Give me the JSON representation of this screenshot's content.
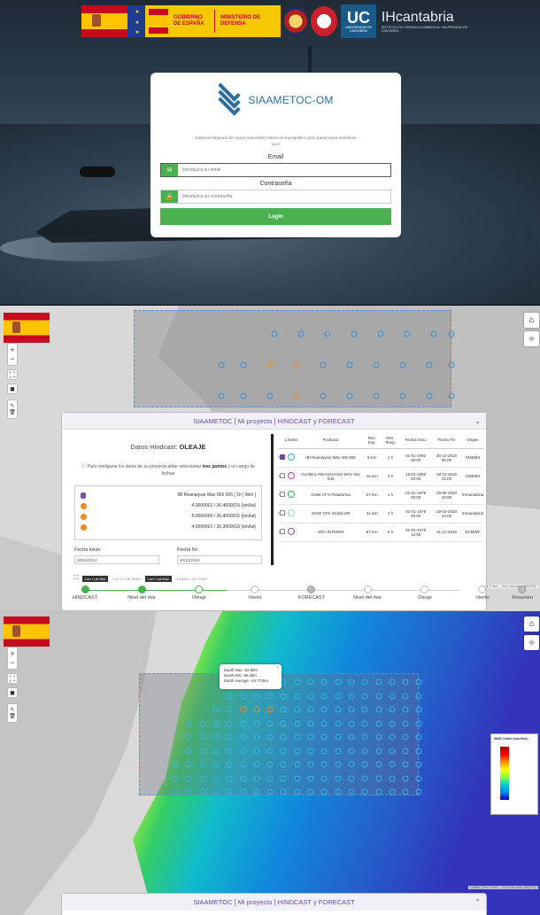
{
  "login": {
    "brand": "SIAAMETOC-OM",
    "subtitle": "- Sistema Integrado de Apoyo Automático Meteo-Oceanográfico para operaciones marítimas -",
    "version": "v1.0",
    "email_label": "Email",
    "email_placeholder": "Introduzca su email",
    "password_label": "Contraseña",
    "password_placeholder": "Introduzca su contraseña",
    "login_button": "Login",
    "logos": {
      "gobierno": "GOBIERNO DE ESPAÑA",
      "ministerio": "MINISTERIO DE DEFENSA",
      "uc": "UC",
      "uc_sub": "UNIVERSIDAD DE CANTABRIA",
      "ih": "IHcantabria",
      "ih_sub": "INSTITUTO DE HIDRÁULICA AMBIENTAL UNIVERSIDAD DE CANTABRIA"
    }
  },
  "modal": {
    "title": "SIAAMETOC [ Mi proyecto ] HINDCAST y FORECAST",
    "heading_prefix": "Datos Hindcast:",
    "heading_value": "OLEAJE",
    "hint_prefix": "Para configurar los datos de su proyecto debe seleccionar",
    "hint_bold": "tres puntos",
    "hint_suffix": "y un rango de fechas",
    "product_line": "IBI Reanalysis Wav 005 006 [ 1h | 9km ]",
    "points": [
      "-4.9000001 / 36.4000015 (lon/lat)",
      "-5.0000000 / 36.4000015 (lon/lat)",
      "-4.9000001 / 36.3000018 (lon/lat)"
    ],
    "start_label": "Fecha inicio:",
    "start_value": "28/12/2014",
    "end_label": "Fecha fin:",
    "end_value": "30/12/2019",
    "lonlat_min_tag": "Lon / Lat Min",
    "lonlat_min": "-5.0771 / 36.30464",
    "lonlat_max_tag": "Lon / Lat Max",
    "lonlat_max": "-4.83464 / 36.77409",
    "table_headers": [
      "Límites",
      "Producto",
      "Res. Esp.",
      "Res. Temp.",
      "Fecha Inicio",
      "Fecha Fin",
      "Origen"
    ],
    "table_rows": [
      {
        "producto": "IBI Reanalysis Wav 005 006",
        "esp": "9 Km",
        "temp": "1 h",
        "inicio": "01-01-1992 00:00",
        "fin": "30-12-2019 00:00",
        "origen": "CMEMS",
        "color": "#2bb3a6",
        "checked": true
      },
      {
        "producto": "GLOBAL REANALYSIS WAV 001 032",
        "esp": "16 Km",
        "temp": "3 h",
        "inicio": "15-01-1993 00:00",
        "fin": "28-12-2018 21:00",
        "origen": "CMEMS",
        "color": "#c43fc0",
        "checked": false
      },
      {
        "producto": "GOW CFS Plataforma",
        "esp": "27 Km",
        "temp": "1 h",
        "inicio": "01-01-1979 00:00",
        "fin": "29-02-2020 23:00",
        "origen": "IHCantabria",
        "color": "#2fae5c",
        "checked": false
      },
      {
        "producto": "GOW CFS Global HR",
        "esp": "41 Km",
        "temp": "1 h",
        "inicio": "01-01-1979 00:00",
        "fin": "29-02-2020 23:00",
        "origen": "IHCantabria",
        "color": "#8ed8c0",
        "checked": false
      },
      {
        "producto": "ERA INTERIM",
        "esp": "87 Km",
        "temp": "6 h",
        "inicio": "01-01-1979 12:00",
        "fin": "31-12-2018",
        "origen": "ECMWF",
        "color": "#8a4fb8",
        "checked": false
      }
    ],
    "steps": [
      "HINDCAST",
      "Nivel del mar",
      "Oleaje",
      "Viento",
      "FORECAST",
      "Nivel del mar",
      "Oleaje",
      "Viento",
      "Resumen"
    ]
  },
  "map_controls": {
    "zoom_in": "+",
    "zoom_out": "−",
    "home": "⌂",
    "layers": "◈"
  },
  "attribution": "Leaflet | Tiles © Esri — Esri, DeLorme, NAVTEQ",
  "tooltip": {
    "max": "Depth Max: -62.59m",
    "min": "Depth Min: -66.59m",
    "avg": "Depth Average: -64.7725m"
  },
  "legend_title": "Multi Colour (sea-floor)",
  "modal2_title": "SIAAMETOC [ Mi proyecto ] HINDCAST y FORECAST",
  "colors": {
    "accent": "#4caf50",
    "brand": "#2c6ea0",
    "title_purple": "#6b4aa0",
    "point_blue": "#3a8fd6",
    "point_selected": "#f08a24"
  }
}
